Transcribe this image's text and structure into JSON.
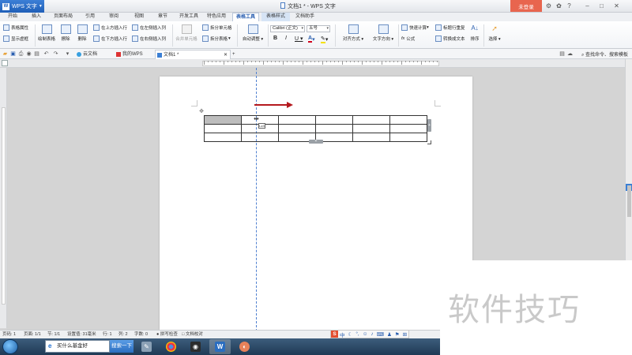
{
  "window": {
    "app_menu": "WPS 文字",
    "title": "文档1 * - WPS 文字",
    "login_label": "未登录"
  },
  "tabs": [
    "开始",
    "插入",
    "页面布局",
    "引用",
    "审阅",
    "视图",
    "章节",
    "开发工具",
    "特色应用",
    "表格工具",
    "表格样式",
    "文档助手"
  ],
  "active_tab": "表格工具",
  "ribbon": {
    "table_props": "表格属性",
    "show_gridlines": "显示虚框",
    "draw_table": "绘制表格",
    "erase": "擦除",
    "delete": "删除",
    "insert_above": "在上方插入行",
    "insert_below": "在下方插入行",
    "insert_left": "在左侧插入列",
    "insert_right": "在右侧插入列",
    "merge_cells": "合并单元格",
    "split_cells": "拆分单元格",
    "split_table": "拆分表格",
    "autofit": "自动调整",
    "font_name": "Calibri (正文)",
    "font_size": "五号",
    "align": "对齐方式",
    "text_dir": "文字方向",
    "quick_calc": "快速计算",
    "formula": "公式",
    "repeat_header": "标题行重复",
    "convert_text": "转换成文本",
    "sort": "排序",
    "select": "选择"
  },
  "doc_tabs": {
    "cloud": "云文档",
    "my_wps": "我的WPS",
    "doc1": "文档1 *",
    "add": "+"
  },
  "command_search": "查找命令、搜索模板",
  "table": {
    "rows": 3,
    "cols": 6,
    "cursor_tip": "Lz3"
  },
  "statusbar": {
    "page": "页码: 1",
    "pages": "页面: 1/1",
    "section": "节: 1/1",
    "position": "设置值: 31毫米",
    "row": "行: 1",
    "col": "列: 2",
    "chars": "字数: 0",
    "spell": "拼写检查",
    "proof": "文档校对"
  },
  "ime": {
    "logo": "S",
    "lang": "中"
  },
  "taskbar": {
    "search_text": "买什么基金好",
    "search_button": "搜索一下"
  },
  "watermark": "软件技巧",
  "colors": {
    "accent": "#2a5fb0",
    "login": "#e8654e",
    "arrow": "#b5191e",
    "selected_cell": "#bdbdbd"
  }
}
